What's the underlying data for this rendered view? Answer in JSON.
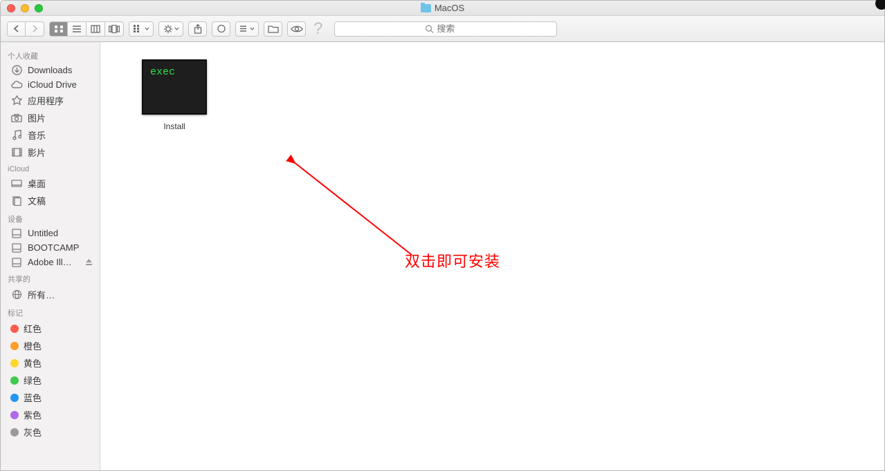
{
  "window": {
    "title": "MacOS"
  },
  "toolbar": {
    "search_placeholder": "搜索"
  },
  "sidebar": {
    "favorites_header": "个人收藏",
    "favorites": [
      {
        "id": "downloads",
        "label": "Downloads",
        "icon": "download-icon"
      },
      {
        "id": "icloud-drive",
        "label": "iCloud Drive",
        "icon": "cloud-icon"
      },
      {
        "id": "applications",
        "label": "应用程序",
        "icon": "applications-icon"
      },
      {
        "id": "pictures",
        "label": "图片",
        "icon": "camera-icon"
      },
      {
        "id": "music",
        "label": "音乐",
        "icon": "music-icon"
      },
      {
        "id": "movies",
        "label": "影片",
        "icon": "film-icon"
      }
    ],
    "icloud_header": "iCloud",
    "icloud": [
      {
        "id": "desktop",
        "label": "桌面",
        "icon": "desktop-icon"
      },
      {
        "id": "documents",
        "label": "文稿",
        "icon": "documents-icon"
      }
    ],
    "devices_header": "设备",
    "devices": [
      {
        "id": "untitled",
        "label": "Untitled",
        "icon": "disk-icon",
        "eject": false
      },
      {
        "id": "bootcamp",
        "label": "BOOTCAMP",
        "icon": "disk-icon",
        "eject": false
      },
      {
        "id": "adobe",
        "label": "Adobe Ill…",
        "icon": "disk-icon",
        "eject": true
      }
    ],
    "shared_header": "共享的",
    "shared": [
      {
        "id": "all",
        "label": "所有…",
        "icon": "globe-icon"
      }
    ],
    "tags_header": "标记",
    "tags": [
      {
        "id": "red",
        "label": "红色",
        "color": "#ff5b4d"
      },
      {
        "id": "orange",
        "label": "橙色",
        "color": "#ff9e2b"
      },
      {
        "id": "yellow",
        "label": "黄色",
        "color": "#ffd52e"
      },
      {
        "id": "green",
        "label": "绿色",
        "color": "#3ecb4c"
      },
      {
        "id": "blue",
        "label": "蓝色",
        "color": "#2196f3"
      },
      {
        "id": "purple",
        "label": "紫色",
        "color": "#b06ae6"
      },
      {
        "id": "gray",
        "label": "灰色",
        "color": "#9a9a9a"
      }
    ]
  },
  "content": {
    "file": {
      "name": "Install",
      "exec_label": "exec"
    }
  },
  "annotation": {
    "text": "双击即可安装"
  }
}
